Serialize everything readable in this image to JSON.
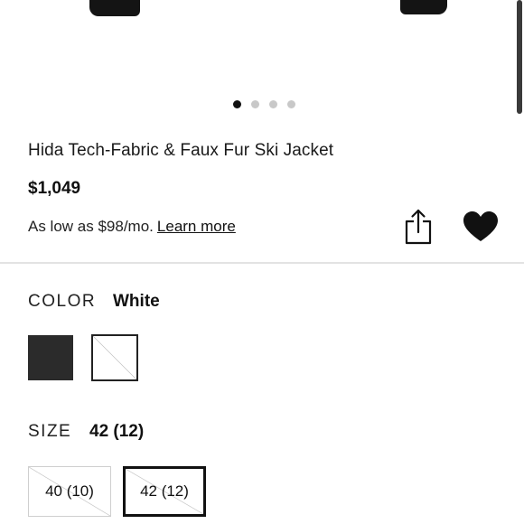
{
  "product": {
    "title": "Hida Tech-Fabric & Faux Fur Ski Jacket",
    "price": "$1,049",
    "financing_text": "As low as $98/mo.",
    "learn_more": "Learn more"
  },
  "gallery": {
    "image_count": 4,
    "active_index": 0
  },
  "color": {
    "label": "COLOR",
    "selected": "White",
    "swatches": [
      {
        "name": "Black",
        "hex": "#2b2b2b",
        "available": true
      },
      {
        "name": "White",
        "hex": "#ffffff",
        "available": false
      }
    ]
  },
  "size": {
    "label": "SIZE",
    "selected": "42 (12)",
    "options": [
      {
        "label": "40 (10)",
        "available": false
      },
      {
        "label": "42 (12)",
        "available": false,
        "selected": true
      }
    ]
  },
  "icons": {
    "share": "share-icon",
    "favorite": "heart-icon"
  }
}
